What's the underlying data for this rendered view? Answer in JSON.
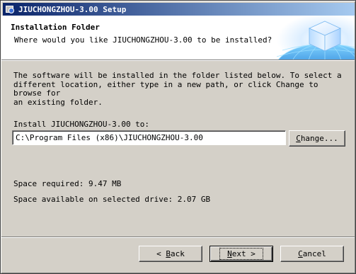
{
  "window": {
    "title": "JIUCHONGZHOU-3.00 Setup"
  },
  "header": {
    "title": "Installation Folder",
    "subtitle": "Where would you like JIUCHONGZHOU-3.00 to be installed?"
  },
  "body": {
    "description": "The software will be installed in the folder listed below. To select a\ndifferent location, either type in a new path, or click Change to browse for\nan existing folder.",
    "install_label": "Install JIUCHONGZHOU-3.00 to:",
    "install_path": "C:\\Program Files (x86)\\JIUCHONGZHOU-3.00",
    "change_button": {
      "mnemonic": "C",
      "rest": "hange..."
    },
    "space_required": "Space required: 9.47 MB",
    "space_available": "Space available on selected drive: 2.07 GB"
  },
  "footer": {
    "back_button": {
      "prefix": "< ",
      "mnemonic": "B",
      "rest": "ack"
    },
    "next_button": {
      "mnemonic": "N",
      "rest": "ext >"
    },
    "cancel_button": {
      "mnemonic": "C",
      "rest": "ancel"
    }
  },
  "icons": {
    "app_icon": "installer-icon",
    "header_art": "globe-cube-icon"
  },
  "colors": {
    "titlebar_start": "#0a246a",
    "titlebar_end": "#a6caf0",
    "dialog_background": "#d4d0c8",
    "header_background": "#ffffff"
  }
}
